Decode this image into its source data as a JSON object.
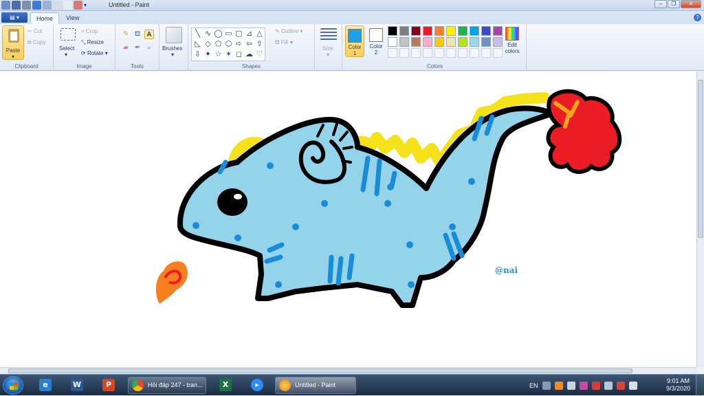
{
  "window": {
    "title": "Untitled - Paint",
    "controls": {
      "minimize": "–",
      "maximize": "❐",
      "close": "✕"
    }
  },
  "ribbon_tabs": {
    "file": "▤ ▾",
    "home": "Home",
    "view": "View",
    "help": "?"
  },
  "clipboard": {
    "paste": "Paste",
    "cut": "Cut",
    "copy": "Copy",
    "group": "Clipboard"
  },
  "image": {
    "select": "Select",
    "crop": "Crop",
    "resize": "Resize",
    "rotate": "Rotate",
    "group": "Image"
  },
  "tools": {
    "group": "Tools",
    "text_tool": "A"
  },
  "brushes": {
    "label": "Brushes"
  },
  "shapes": {
    "group": "Shapes",
    "outline": "Outline",
    "fill": "Fill",
    "items": [
      "╲",
      "∿",
      "◯",
      "▭",
      "▢",
      "⊿",
      "△",
      "◺",
      "◇",
      "⬠",
      "⬡",
      "➪",
      "⇦",
      "⇧",
      "⇩",
      "✦",
      "☆",
      "✶",
      "◻",
      "☁",
      "♡"
    ]
  },
  "size": {
    "label": "Size"
  },
  "colors": {
    "group": "Colors",
    "color1_label": "Color",
    "color1_num": "1",
    "color2_label": "Color",
    "color2_num": "2",
    "color1": "#1ea0e6",
    "color2": "#ffffff",
    "edit_label": "Edit",
    "edit_label2": "colors",
    "palette": [
      "#000000",
      "#7f7f7f",
      "#880015",
      "#ed1c24",
      "#ff7f27",
      "#fff200",
      "#22b14c",
      "#00a2e8",
      "#3f48cc",
      "#a349a4",
      "#ffffff",
      "#c3c3c3",
      "#b97a57",
      "#ffaec9",
      "#ffc90e",
      "#efe4b0",
      "#b5e61d",
      "#99d9ea",
      "#7092be",
      "#c8bfe7"
    ]
  },
  "canvas": {
    "signature": "@nai"
  },
  "taskbar": {
    "tasks": [
      {
        "label": "Hỏi đáp 247 - tran...",
        "name": "chrome-task"
      },
      {
        "label": "Untitled - Paint",
        "name": "paint-task"
      }
    ],
    "tray_lang": "EN",
    "time": "9:01 AM",
    "date": "9/3/2020"
  }
}
